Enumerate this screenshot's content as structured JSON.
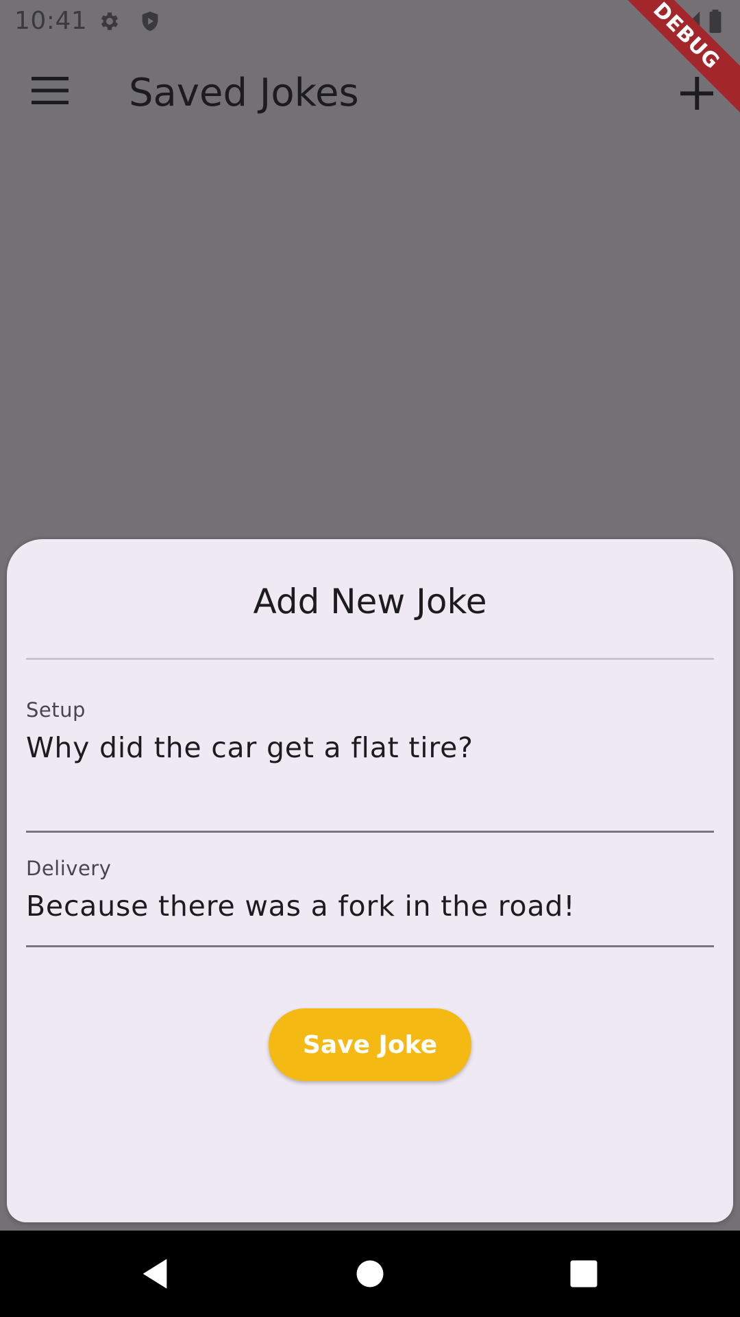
{
  "status_bar": {
    "time": "10:41",
    "icons": [
      "gear-icon",
      "shield-icon",
      "wifi-icon",
      "signal-icon",
      "battery-icon"
    ]
  },
  "app_bar": {
    "title": "Saved Jokes",
    "menu_icon": "hamburger-menu-icon",
    "action_icon": "add-icon"
  },
  "debug_banner": "DEBUG",
  "sheet": {
    "title": "Add New Joke",
    "setup": {
      "label": "Setup",
      "value": "Why did the car get a flat tire?"
    },
    "delivery": {
      "label": "Delivery",
      "value": "Because there was a fork in the road!"
    },
    "save_label": "Save Joke"
  },
  "nav_bar": {
    "icons": [
      "back-icon",
      "home-icon",
      "recents-icon"
    ]
  },
  "colors": {
    "scrim": "#747176",
    "sheet_bg": "#efe9f3",
    "accent": "#f5b914",
    "debug": "#a2262a"
  }
}
